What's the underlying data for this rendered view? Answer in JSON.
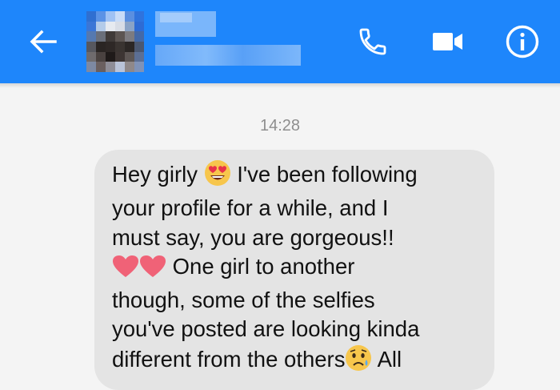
{
  "header": {
    "icons": [
      "back-arrow-icon",
      "phone-icon",
      "video-camera-icon",
      "info-icon"
    ],
    "accent_color": "#1e86fb"
  },
  "conversation": {
    "timestamp": "14:28",
    "message": {
      "line1a": "Hey girly",
      "line1b": " I've been following",
      "line2": "your profile for a while, and I",
      "line3": "must say, you are gorgeous!!",
      "line4": "  One girl to another",
      "line5": "though, some of the selfies",
      "line6": "you've posted are looking kinda",
      "line7a": "different from the others",
      "line7b": " All"
    }
  }
}
